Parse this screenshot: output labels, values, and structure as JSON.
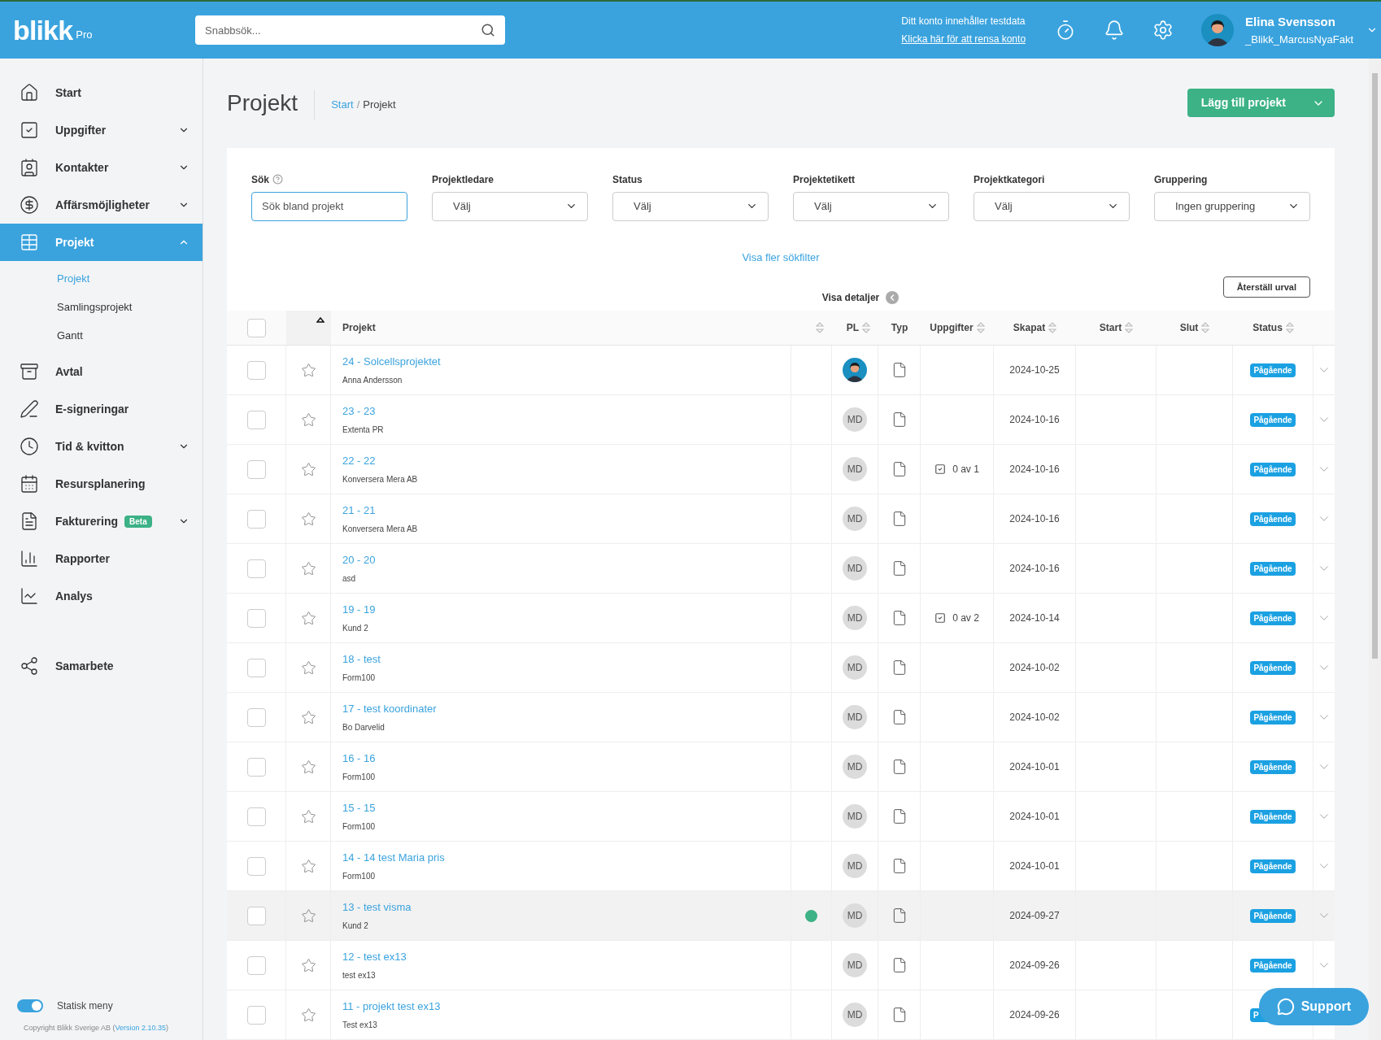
{
  "header": {
    "logo": "blikk",
    "logo_suffix": "Pro",
    "search": {
      "placeholder": "Snabbsök..."
    },
    "notice": "Ditt konto innehåller testdata",
    "notice_link": "Klicka här för att rensa konto",
    "user": {
      "name": "Elina Svensson",
      "account": "_Blikk_MarcusNyaFakt"
    }
  },
  "sidebar": {
    "items": [
      {
        "label": "Start",
        "selected": false
      },
      {
        "label": "Uppgifter",
        "expanded": false,
        "selected": false
      },
      {
        "label": "Kontakter",
        "expanded": false,
        "selected": false
      },
      {
        "label": "Affärsmöjligheter",
        "expanded": false,
        "selected": false
      },
      {
        "label": "Projekt",
        "expanded": true,
        "selected": true,
        "children": [
          {
            "label": "Projekt",
            "selected": true
          },
          {
            "label": "Samlingsprojekt",
            "selected": false
          },
          {
            "label": "Gantt",
            "selected": false
          }
        ]
      },
      {
        "label": "Avtal",
        "selected": false
      },
      {
        "label": "E-signeringar",
        "selected": false
      },
      {
        "label": "Tid & kvitton",
        "expanded": false,
        "selected": false
      },
      {
        "label": "Resursplanering",
        "selected": false
      },
      {
        "label": "Fakturering",
        "badge": "Beta",
        "expanded": false,
        "selected": false
      },
      {
        "label": "Rapporter",
        "selected": false
      },
      {
        "label": "Analys",
        "selected": false
      },
      {
        "label": "Samarbete",
        "selected": false
      }
    ],
    "static_menu": {
      "label": "Statisk meny",
      "on": true
    },
    "copyright": "Copyright Blikk Sverige AB (",
    "version": "Version 2.10.35",
    "copyright_end": ")"
  },
  "page": {
    "title": "Projekt",
    "breadcrumb": [
      {
        "label": "Start",
        "link": true
      },
      {
        "label": "Projekt",
        "link": false
      }
    ],
    "breadcrumb_separator": "/",
    "add_button": "Lägg till projekt"
  },
  "filters": [
    {
      "label": "Sök",
      "kind": "text",
      "placeholder": "Sök bland projekt",
      "help": true
    },
    {
      "label": "Projektledare",
      "kind": "select",
      "value": "Välj"
    },
    {
      "label": "Status",
      "kind": "select",
      "value": "Välj"
    },
    {
      "label": "Projektetikett",
      "kind": "select",
      "value": "Välj"
    },
    {
      "label": "Projektkategori",
      "kind": "select",
      "value": "Välj"
    },
    {
      "label": "Gruppering",
      "kind": "select",
      "value": "Ingen gruppering"
    }
  ],
  "more_filters": "Visa fler sökfilter",
  "show_details": "Visa detaljer",
  "reset": "Återställ urval",
  "table": {
    "select_all_checked": false,
    "columns": [
      "Projekt",
      "PL",
      "Typ",
      "Uppgifter",
      "Skapat",
      "Start",
      "Slut",
      "Status"
    ],
    "rows": [
      {
        "title": "24 - Solcellsprojektet",
        "client": "Anna Andersson",
        "pl": {
          "kind": "photo"
        },
        "created": "2024-10-25",
        "status": "Pågående",
        "highlighted": false
      },
      {
        "title": "23 - 23",
        "client": "Extenta PR",
        "pl": {
          "kind": "initials",
          "text": "MD"
        },
        "created": "2024-10-16",
        "status": "Pågående",
        "highlighted": false
      },
      {
        "title": "22 - 22",
        "client": "Konversera Mera AB",
        "pl": {
          "kind": "initials",
          "text": "MD"
        },
        "tasks": "0 av 1",
        "created": "2024-10-16",
        "status": "Pågående",
        "highlighted": false
      },
      {
        "title": "21 - 21",
        "client": "Konversera Mera AB",
        "pl": {
          "kind": "initials",
          "text": "MD"
        },
        "created": "2024-10-16",
        "status": "Pågående",
        "highlighted": false
      },
      {
        "title": "20 - 20",
        "client": "asd",
        "pl": {
          "kind": "initials",
          "text": "MD"
        },
        "created": "2024-10-16",
        "status": "Pågående",
        "highlighted": false
      },
      {
        "title": "19 - 19",
        "client": "Kund 2",
        "pl": {
          "kind": "initials",
          "text": "MD"
        },
        "tasks": "0 av 2",
        "created": "2024-10-14",
        "status": "Pågående",
        "highlighted": false
      },
      {
        "title": "18 - test",
        "client": "Form100",
        "pl": {
          "kind": "initials",
          "text": "MD"
        },
        "created": "2024-10-02",
        "status": "Pågående",
        "highlighted": false
      },
      {
        "title": "17 - test koordinater",
        "client": "Bo Darvelid",
        "pl": {
          "kind": "initials",
          "text": "MD"
        },
        "created": "2024-10-02",
        "status": "Pågående",
        "highlighted": false
      },
      {
        "title": "16 - 16",
        "client": "Form100",
        "pl": {
          "kind": "initials",
          "text": "MD"
        },
        "created": "2024-10-01",
        "status": "Pågående",
        "highlighted": false
      },
      {
        "title": "15 - 15",
        "client": "Form100",
        "pl": {
          "kind": "initials",
          "text": "MD"
        },
        "created": "2024-10-01",
        "status": "Pågående",
        "highlighted": false
      },
      {
        "title": "14 - 14 test Maria pris",
        "client": "Form100",
        "pl": {
          "kind": "initials",
          "text": "MD"
        },
        "created": "2024-10-01",
        "status": "Pågående",
        "highlighted": false
      },
      {
        "title": "13 - test visma",
        "client": "Kund 2",
        "color": "#3cb286",
        "pl": {
          "kind": "initials",
          "text": "MD"
        },
        "created": "2024-09-27",
        "status": "Pågående",
        "highlighted": true
      },
      {
        "title": "12 - test ex13",
        "client": "test ex13",
        "pl": {
          "kind": "initials",
          "text": "MD"
        },
        "created": "2024-09-26",
        "status": "Pågående",
        "highlighted": false
      },
      {
        "title": "11 - projekt test ex13",
        "client": "Test ex13",
        "pl": {
          "kind": "initials",
          "text": "MD"
        },
        "created": "2024-09-26",
        "status": "P",
        "highlighted": false
      }
    ]
  },
  "support": "Support"
}
